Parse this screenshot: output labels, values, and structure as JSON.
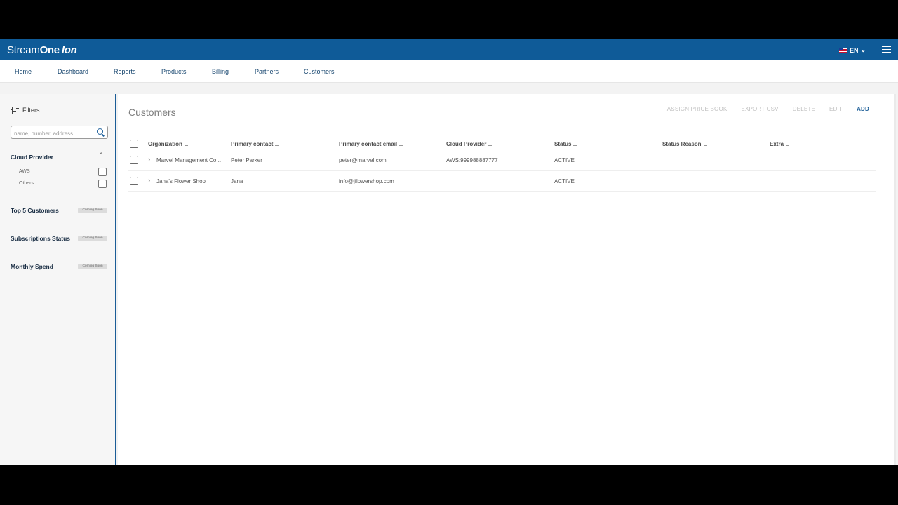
{
  "header": {
    "logo_part1": "Stream",
    "logo_part2": "One",
    "logo_part3": "Ion",
    "language": "EN"
  },
  "nav": [
    "Home",
    "Dashboard",
    "Reports",
    "Products",
    "Billing",
    "Partners",
    "Customers"
  ],
  "sidebar": {
    "filters_label": "Filters",
    "search_placeholder": "name, number, address",
    "cloud_provider": {
      "title": "Cloud Provider",
      "options": [
        "AWS",
        "Others"
      ]
    },
    "sections": [
      {
        "title": "Top 5 Customers",
        "badge": "Coming Soon"
      },
      {
        "title": "Subscriptions Status",
        "badge": "Coming Soon"
      },
      {
        "title": "Monthly Spend",
        "badge": "Coming Soon"
      }
    ]
  },
  "main": {
    "title": "Customers",
    "actions": [
      "ASSIGN PRICE BOOK",
      "EXPORT CSV",
      "DELETE",
      "EDIT",
      "ADD"
    ]
  },
  "table": {
    "headers": [
      "Organization",
      "Primary contact",
      "Primary contact email",
      "Cloud Provider",
      "Status",
      "Status Reason",
      "Extra"
    ],
    "rows": [
      {
        "organization": "Marvel Management Co...",
        "contact": "Peter Parker",
        "email": "peter@marvel.com",
        "cloud": "AWS:999988887777",
        "status": "ACTIVE",
        "reason": "",
        "extra": ""
      },
      {
        "organization": "Jana's Flower Shop",
        "contact": "Jana",
        "email": "info@jflowershop.com",
        "cloud": "",
        "status": "ACTIVE",
        "reason": "",
        "extra": ""
      }
    ]
  }
}
